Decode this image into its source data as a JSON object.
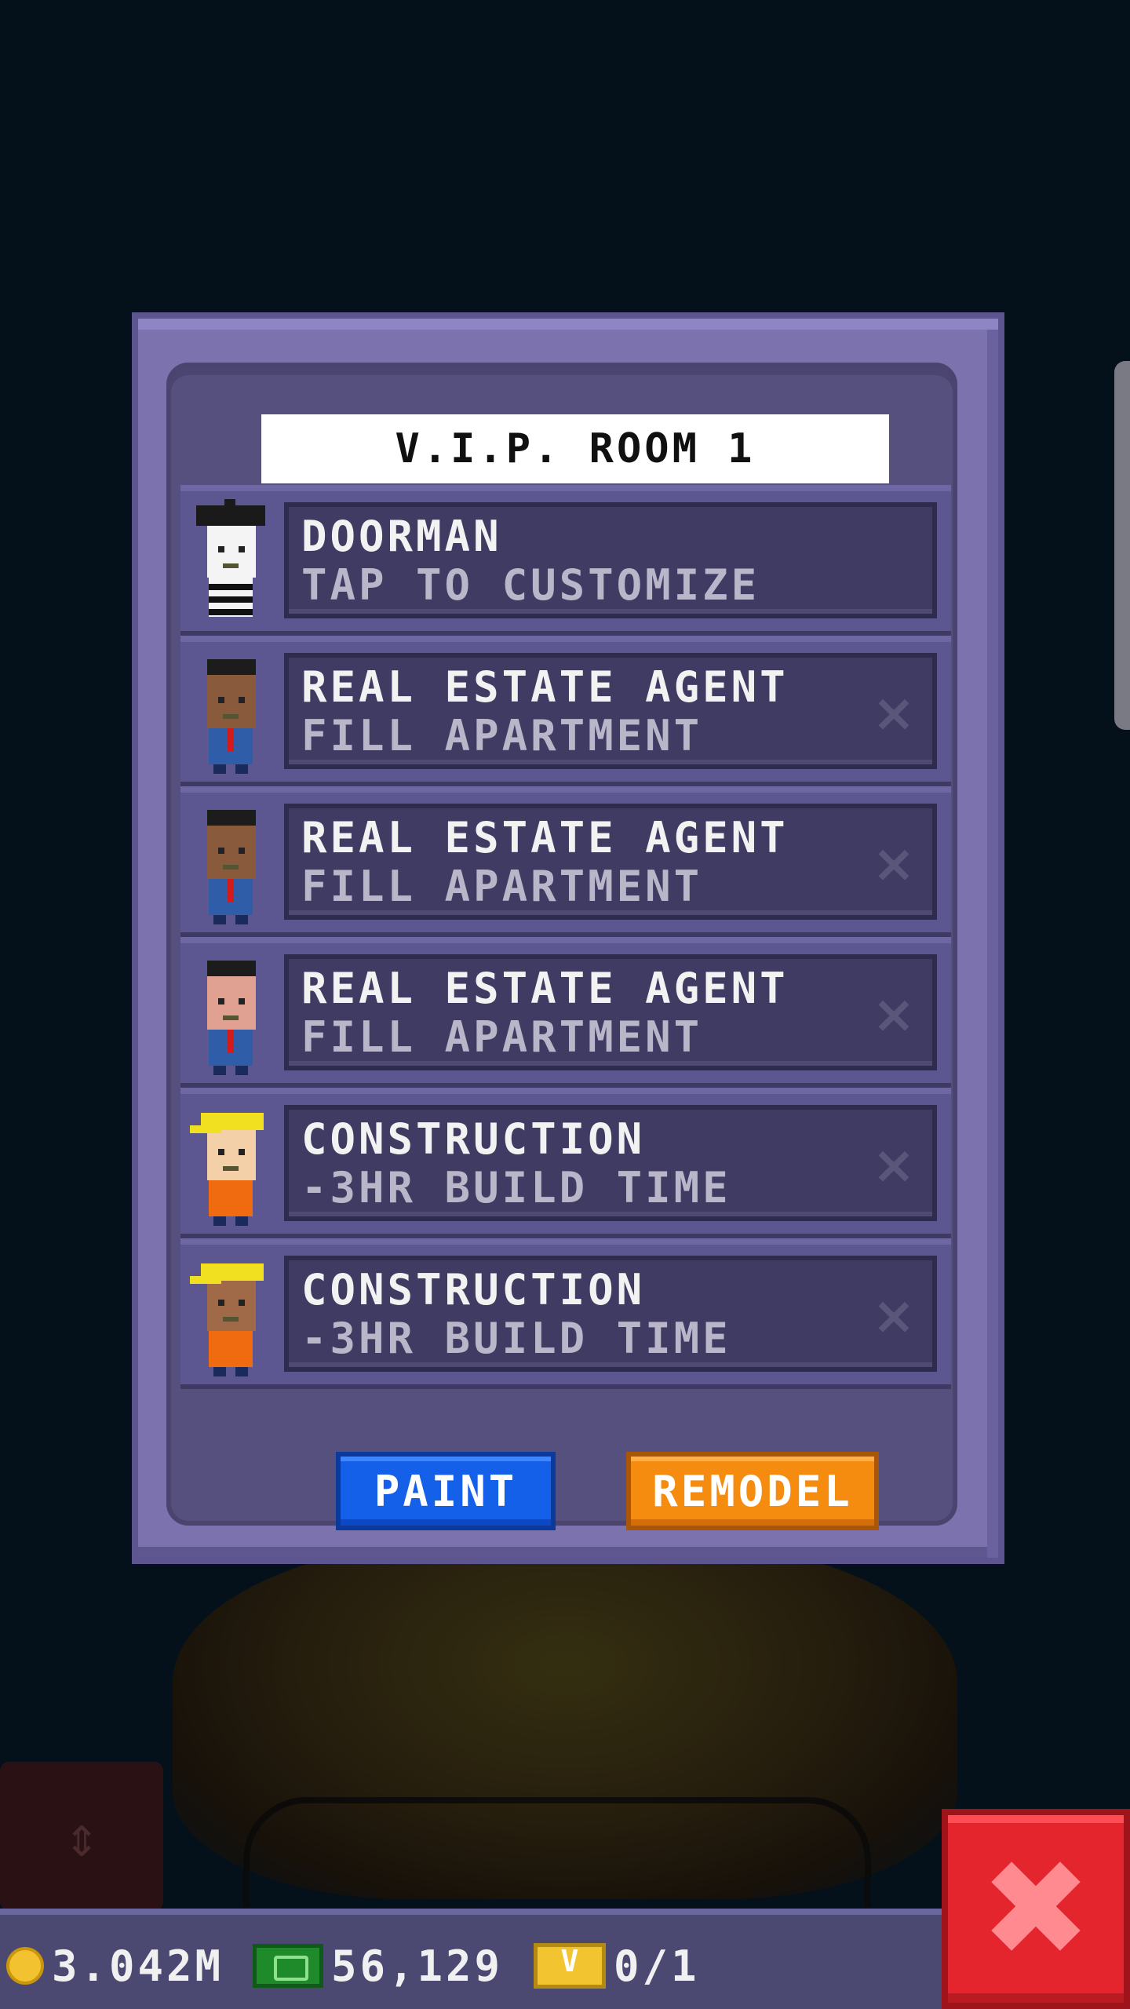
{
  "modal": {
    "title": "V.I.P. ROOM 1",
    "staff": [
      {
        "role": "DOORMAN",
        "subtitle": "TAP TO CUSTOMIZE",
        "avatar": "mime-doorman-avatar",
        "skin": "#f4f4f4",
        "hair": "#1a1a1a",
        "shirt": "stripes",
        "evict": false
      },
      {
        "role": "REAL ESTATE AGENT",
        "subtitle": "FILL APARTMENT",
        "avatar": "agent-avatar",
        "skin": "#8a5a3c",
        "hair": "#1c1c1c",
        "shirt": "#2f5da8",
        "evict": true
      },
      {
        "role": "REAL ESTATE AGENT",
        "subtitle": "FILL APARTMENT",
        "avatar": "agent-avatar",
        "skin": "#8a5a3c",
        "hair": "#1c1c1c",
        "shirt": "#2f5da8",
        "evict": true
      },
      {
        "role": "REAL ESTATE AGENT",
        "subtitle": "FILL APARTMENT",
        "avatar": "agent-avatar",
        "skin": "#e0a092",
        "hair": "#1c1c1c",
        "shirt": "#2f5da8",
        "evict": true
      },
      {
        "role": "CONSTRUCTION",
        "subtitle": "-3HR BUILD TIME",
        "avatar": "construction-worker-avatar",
        "skin": "#f4d0a8",
        "hair": "#f0e020",
        "shirt": "#f06a10",
        "evict": true
      },
      {
        "role": "CONSTRUCTION",
        "subtitle": "-3HR BUILD TIME",
        "avatar": "construction-worker-avatar",
        "skin": "#a06a48",
        "hair": "#f0e020",
        "shirt": "#f06a10",
        "evict": true
      }
    ],
    "paint_label": "PAINT",
    "remodel_label": "REMODEL"
  },
  "hud": {
    "coins": "3.042M",
    "bux": "56,129",
    "tickets": "0/1"
  },
  "icons": {
    "evict": "×",
    "close": "✖",
    "elevator": "⇕"
  },
  "colors": {
    "panel": "#7b72ae",
    "paint_button": "#1560e8",
    "remodel_button": "#f58c10",
    "close_button": "#e5252d"
  }
}
